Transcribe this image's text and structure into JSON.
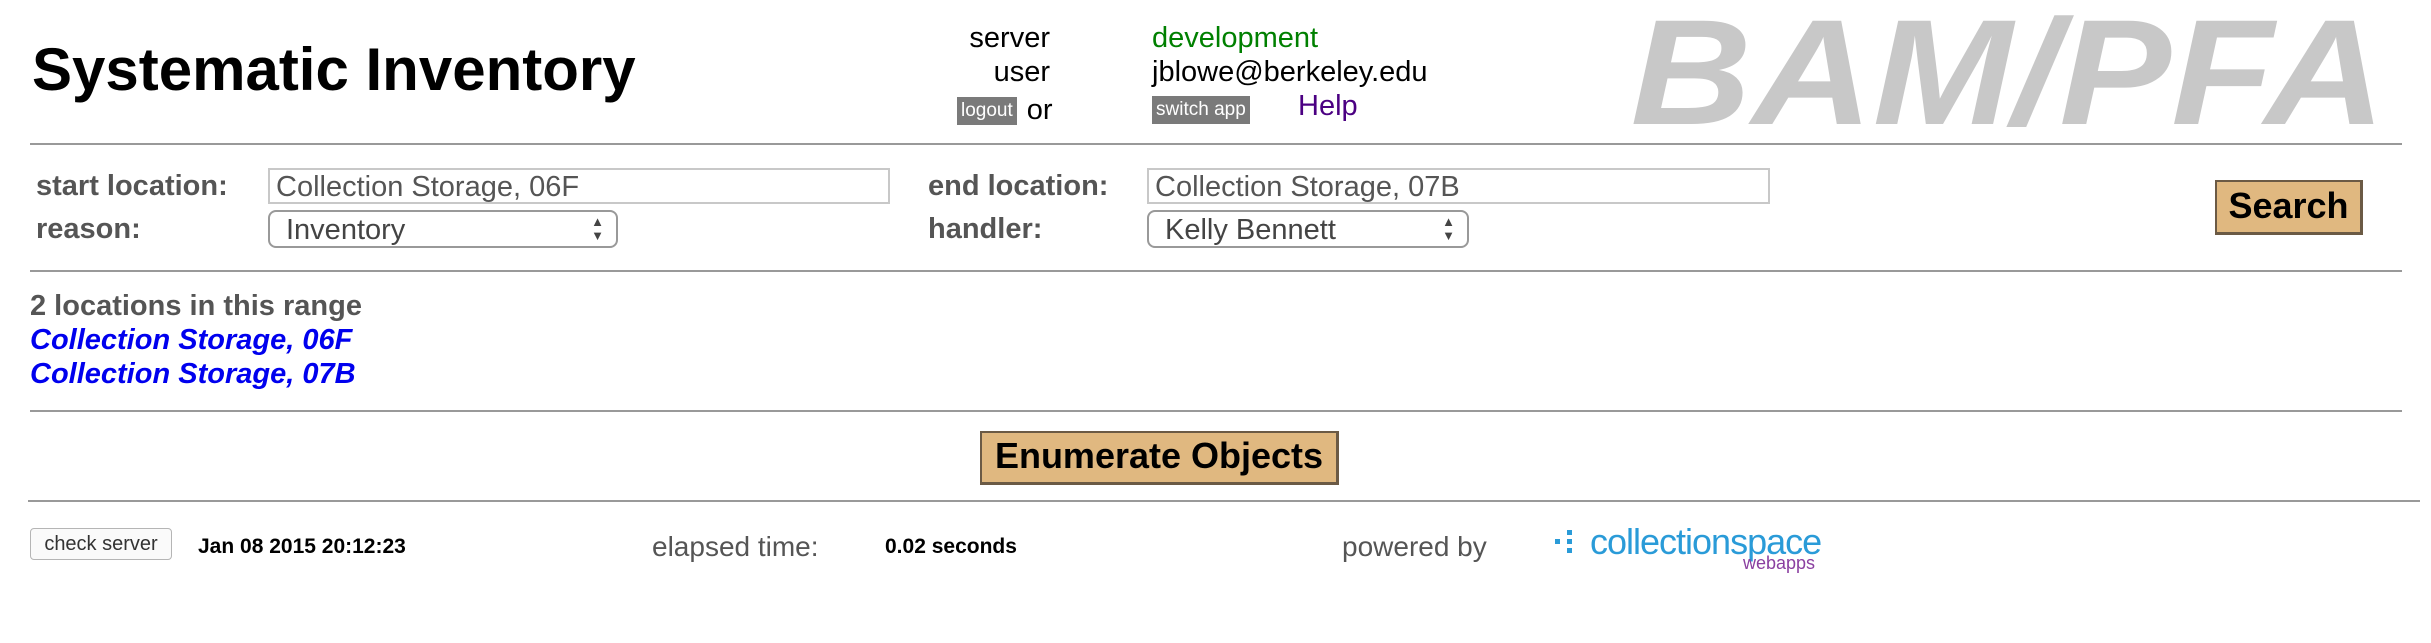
{
  "header": {
    "title": "Systematic Inventory",
    "server_label": "server",
    "server_value": "development",
    "user_label": "user",
    "user_value": "jblowe@berkeley.edu",
    "logout_label": "logout",
    "or_text": "or",
    "switch_app_label": "switch app",
    "help_label": "Help",
    "logo_text": "BAM/PFA"
  },
  "form": {
    "start_location_label": "start location:",
    "start_location_value": "Collection Storage, 06F",
    "end_location_label": "end location:",
    "end_location_value": "Collection Storage, 07B",
    "reason_label": "reason:",
    "reason_value": "Inventory",
    "handler_label": "handler:",
    "handler_value": "Kelly Bennett",
    "search_label": "Search"
  },
  "results": {
    "count_text": "2 locations in this range",
    "locations": [
      "Collection Storage, 06F",
      "Collection Storage, 07B"
    ],
    "enumerate_label": "Enumerate Objects"
  },
  "footer": {
    "check_server_label": "check server",
    "date": "Jan 08 2015 20:12:23",
    "elapsed_label": "elapsed time:",
    "elapsed_value": "0.02 seconds",
    "powered_by_label": "powered by",
    "cs_name": "collectionspace",
    "cs_sub": "webapps"
  },
  "colors": {
    "server_value": "#008000",
    "help_link": "#4b0082",
    "location_link": "#0000ee",
    "button_tan": "#e0b880",
    "logo_gray": "#c8c8c8",
    "cs_blue": "#2a9bd8",
    "cs_purple": "#8a3fa0"
  }
}
